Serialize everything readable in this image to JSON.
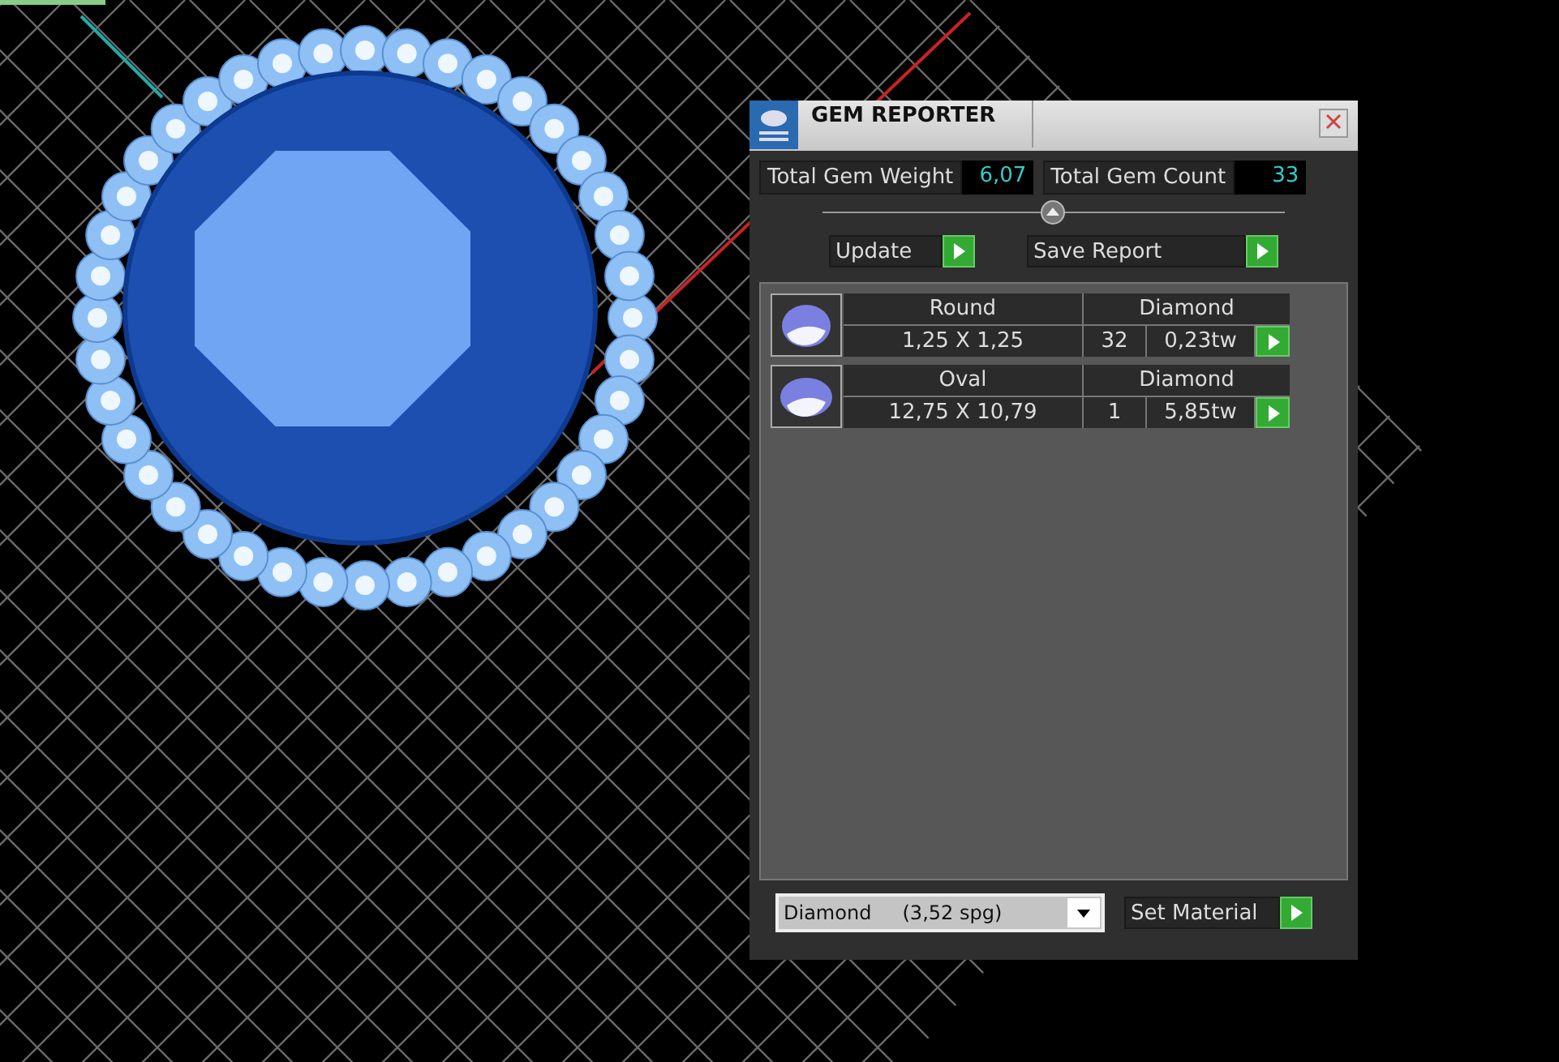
{
  "window": {
    "title": "GEM REPORTER"
  },
  "totals": [
    {
      "label": "Total Gem Weight",
      "value": "6,07"
    },
    {
      "label": "Total Gem Count",
      "value": "33"
    }
  ],
  "actions": [
    "Update",
    "Save Report"
  ],
  "gems": [
    {
      "shape": "Round",
      "material": "Diamond",
      "size": "1,25 X 1,25",
      "count": "32",
      "weight": "0,23tw"
    },
    {
      "shape": "Oval",
      "material": "Diamond",
      "size": "12,75 X 10,79",
      "count": "1",
      "weight": "5,85tw"
    }
  ],
  "material_select": {
    "value": "Diamond     (3,52 spg)"
  },
  "set_material": "Set Material"
}
